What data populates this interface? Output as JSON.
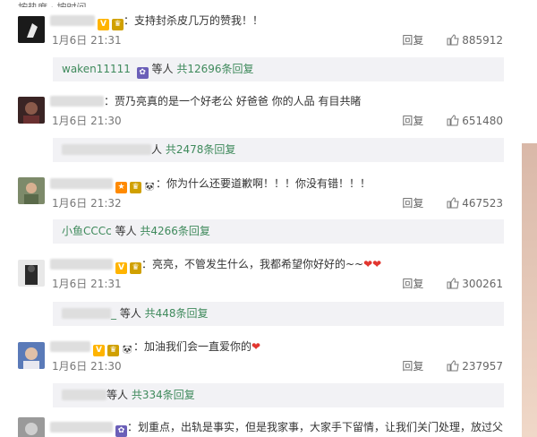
{
  "top_partial_text": "按热度 · 按时间",
  "comments": [
    {
      "text": "：支持封杀皮几万的赞我！！",
      "time": "1月6日 21:31",
      "reply_label": "回复",
      "likes": "885912",
      "replies_name": "waken11111",
      "replies_mid": " 等人 ",
      "replies_count": "共12696条回复",
      "avatar_color": "#1a1a1a"
    },
    {
      "text": "：贾乃亮真的是一个好老公 好爸爸 你的人品 有目共睹",
      "time": "1月6日 21:30",
      "reply_label": "回复",
      "likes": "651480",
      "replies_name": "",
      "replies_mid": "人 ",
      "replies_count": "共2478条回复",
      "avatar_color": "#5a2a2a"
    },
    {
      "text": "：你为什么还要道歉啊！！！你没有错！！！",
      "time": "1月6日 21:32",
      "reply_label": "回复",
      "likes": "467523",
      "replies_name": "小鱼CCCc",
      "replies_mid": " 等人 ",
      "replies_count": "共4266条回复",
      "avatar_color": "#6b7a5a"
    },
    {
      "text": "：亮亮，不管发生什么，我都希望你好好的~~",
      "time": "1月6日 21:31",
      "reply_label": "回复",
      "likes": "300261",
      "replies_name": "_",
      "replies_mid": " 等人 ",
      "replies_count": "共448条回复",
      "avatar_color": "#444444"
    },
    {
      "text": "：加油我们会一直爱你的",
      "time": "1月6日 21:30",
      "reply_label": "回复",
      "likes": "237957",
      "replies_name": "",
      "replies_mid": "等人 ",
      "replies_count": "共334条回复",
      "avatar_color": "#4a6aa8"
    },
    {
      "text": "：划重点，出轨是事实，但是我家事，大家手下留情，让我们关门处理，放过父",
      "time": "",
      "reply_label": "",
      "likes": "",
      "replies_name": "",
      "replies_mid": "",
      "replies_count": "",
      "avatar_color": "#777777"
    }
  ],
  "colors": {
    "reply_name": "#3f8a5c",
    "heart": "#e2362f",
    "reply_box": "#f2f2f5"
  },
  "icons": [
    "thumb-up-icon",
    "heart-icon",
    "vip-badge-icon",
    "panda-icon"
  ]
}
